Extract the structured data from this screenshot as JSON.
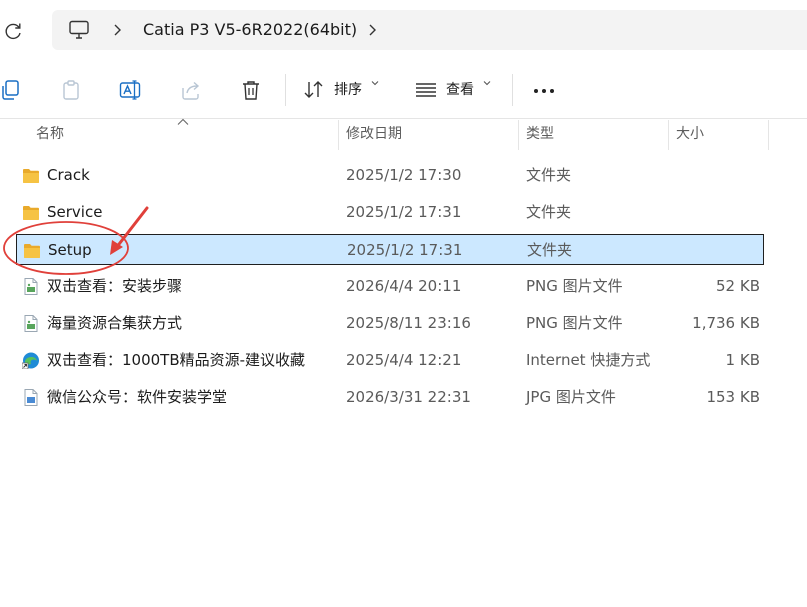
{
  "address_bar": {
    "refresh_icon": "refresh-icon",
    "location_icon": "this-pc-icon",
    "path": [
      "Catia P3 V5-6R2022(64bit)"
    ]
  },
  "toolbar": {
    "sort_label": "排序",
    "view_label": "查看",
    "more_label": "..."
  },
  "columns": {
    "name": "名称",
    "date": "修改日期",
    "type": "类型",
    "size": "大小"
  },
  "files": [
    {
      "name": "Crack",
      "date": "2025/1/2 17:30",
      "type": "文件夹",
      "size": "",
      "icon": "folder-icon",
      "selected": false
    },
    {
      "name": "Service",
      "date": "2025/1/2 17:31",
      "type": "文件夹",
      "size": "",
      "icon": "folder-icon",
      "selected": false
    },
    {
      "name": "Setup",
      "date": "2025/1/2 17:31",
      "type": "文件夹",
      "size": "",
      "icon": "folder-icon",
      "selected": true
    },
    {
      "name": "双击查看：安装步骤",
      "date": "2026/4/4 20:11",
      "type": "PNG 图片文件",
      "size": "52 KB",
      "icon": "png-file-icon",
      "selected": false
    },
    {
      "name": "海量资源合集获方式",
      "date": "2025/8/11 23:16",
      "type": "PNG 图片文件",
      "size": "1,736 KB",
      "icon": "png-file-icon",
      "selected": false
    },
    {
      "name": "双击查看：1000TB精品资源-建议收藏",
      "date": "2025/4/4 12:21",
      "type": "Internet 快捷方式",
      "size": "1 KB",
      "icon": "edge-shortcut-icon",
      "selected": false
    },
    {
      "name": "微信公众号：软件安装学堂",
      "date": "2026/3/31 22:31",
      "type": "JPG 图片文件",
      "size": "153 KB",
      "icon": "jpg-file-icon",
      "selected": false
    }
  ],
  "colors": {
    "selection_fill": "#cce8ff",
    "annotation_red": "#e0403a",
    "folder_yellow": "#f6c343"
  }
}
